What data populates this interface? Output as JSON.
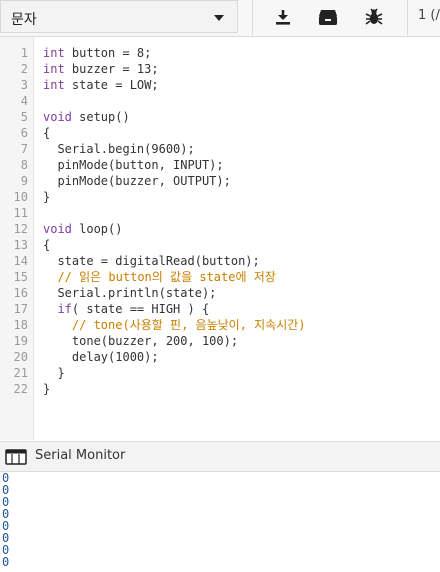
{
  "toolbar": {
    "dropdown_value": "문자",
    "page_tab": "1 (/",
    "icons": [
      "download-icon",
      "archive-icon",
      "bug-icon"
    ]
  },
  "editor": {
    "line_numbers": [
      "1",
      "2",
      "3",
      "4",
      "5",
      "6",
      "7",
      "8",
      "9",
      "10",
      "11",
      "12",
      "13",
      "14",
      "15",
      "16",
      "17",
      "18",
      "19",
      "20",
      "21",
      "22"
    ],
    "lines": [
      "int button = 8;",
      "int buzzer = 13;",
      "int state = LOW;",
      "",
      "void setup()",
      "{",
      "  Serial.begin(9600);",
      "  pinMode(button, INPUT);",
      "  pinMode(buzzer, OUTPUT);",
      "}",
      "",
      "void loop()",
      "{",
      "  state = digitalRead(button);",
      "  // 읽은 button의 값을 state에 저장",
      "  Serial.println(state);",
      "  if( state == HIGH ) {",
      "    // tone(사용할 핀, 음높낮이, 지속시간)",
      "    tone(buzzer, 200, 100);",
      "    delay(1000);",
      "  }",
      "}"
    ]
  },
  "serial_monitor": {
    "title": "Serial Monitor",
    "output": [
      "0",
      "0",
      "0",
      "0",
      "0",
      "0",
      "0",
      "0"
    ]
  },
  "colors": {
    "keyword": "#7a3e9d",
    "comment": "#c77f00",
    "serial_text": "#1f5a9a"
  }
}
